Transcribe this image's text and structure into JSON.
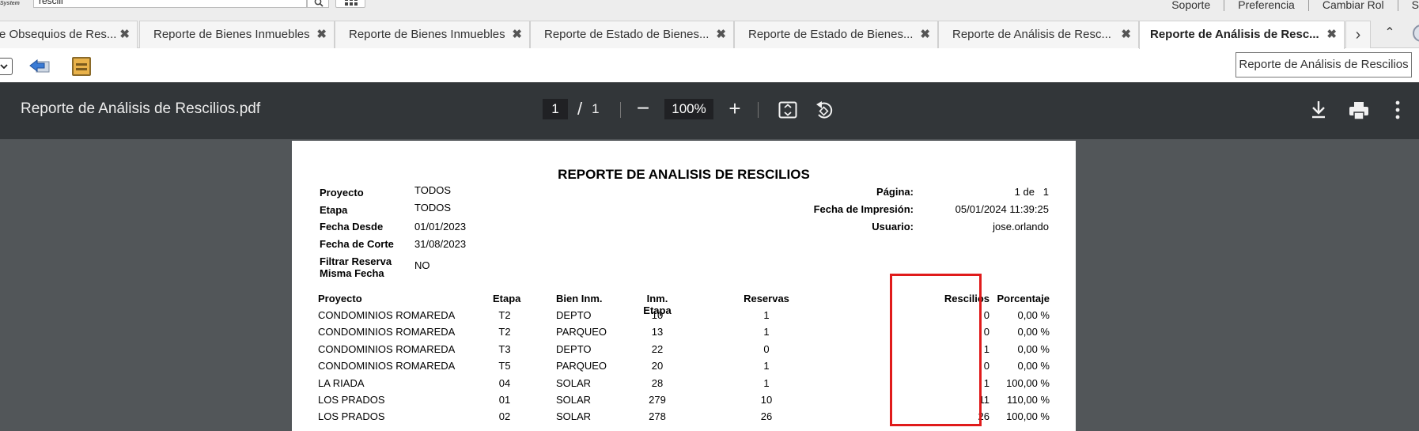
{
  "app": {
    "logo_text": "System",
    "search_value": "rescili",
    "top_links": [
      "Soporte",
      "Preferencia",
      "Cambiar Rol",
      "S"
    ]
  },
  "tabs": [
    {
      "label": "e Obsequios de Res...",
      "active": false
    },
    {
      "label": "Reporte de Bienes Inmuebles",
      "active": false
    },
    {
      "label": "Reporte de Bienes Inmuebles",
      "active": false
    },
    {
      "label": "Reporte de Estado de Bienes...",
      "active": false
    },
    {
      "label": "Reporte de Estado de Bienes...",
      "active": false
    },
    {
      "label": "Reporte de Análisis de Resc...",
      "active": false
    },
    {
      "label": "Reporte de Análisis de Resc...",
      "active": true
    }
  ],
  "tab_controls": {
    "next": "›",
    "collapse": "⌃",
    "close": "✖"
  },
  "tooltip": "Reporte de Análisis de Rescilios",
  "viewer": {
    "file_name": "Reporte de Análisis de Rescilios.pdf",
    "page_current": "1",
    "page_separator": "/",
    "page_total": "1",
    "zoom": "100%",
    "zoom_out": "−",
    "zoom_in": "+"
  },
  "report": {
    "title": "REPORTE DE ANALISIS DE RESCILIOS",
    "header_left": [
      {
        "label": "Proyecto",
        "value": "TODOS"
      },
      {
        "label": "Etapa",
        "value": "TODOS"
      },
      {
        "label": "Fecha Desde",
        "value": "01/01/2023"
      },
      {
        "label": "Fecha de Corte",
        "value": "31/08/2023"
      },
      {
        "label": "Filtrar Reserva",
        "label2": "Misma Fecha",
        "value": "NO"
      }
    ],
    "header_right": [
      {
        "label": "Página:",
        "value": "1 de   1"
      },
      {
        "label": "Fecha de Impresión:",
        "value": "05/01/2024 11:39:25"
      },
      {
        "label": "Usuario:",
        "value": "jose.orlando"
      }
    ],
    "columns": {
      "proyecto": "Proyecto",
      "etapa": "Etapa",
      "bien": "Bien Inm.",
      "inm_etapa": "Inm. Etapa",
      "reservas": "Reservas",
      "rescilios": "Rescilios",
      "porcentaje": "Porcentaje"
    },
    "rows": [
      {
        "proyecto": "CONDOMINIOS ROMAREDA",
        "etapa": "T2",
        "bien": "DEPTO",
        "inm_etapa": "10",
        "reservas": "1",
        "rescilios": "0",
        "porcentaje": "0,00 %"
      },
      {
        "proyecto": "CONDOMINIOS ROMAREDA",
        "etapa": "T2",
        "bien": "PARQUEO",
        "inm_etapa": "13",
        "reservas": "1",
        "rescilios": "0",
        "porcentaje": "0,00 %"
      },
      {
        "proyecto": "CONDOMINIOS ROMAREDA",
        "etapa": "T3",
        "bien": "DEPTO",
        "inm_etapa": "22",
        "reservas": "0",
        "rescilios": "1",
        "porcentaje": "0,00 %"
      },
      {
        "proyecto": "CONDOMINIOS ROMAREDA",
        "etapa": "T5",
        "bien": "PARQUEO",
        "inm_etapa": "20",
        "reservas": "1",
        "rescilios": "0",
        "porcentaje": "0,00 %"
      },
      {
        "proyecto": "LA RIADA",
        "etapa": "04",
        "bien": "SOLAR",
        "inm_etapa": "28",
        "reservas": "1",
        "rescilios": "1",
        "porcentaje": "100,00 %"
      },
      {
        "proyecto": "LOS PRADOS",
        "etapa": "01",
        "bien": "SOLAR",
        "inm_etapa": "279",
        "reservas": "10",
        "rescilios": "11",
        "porcentaje": "110,00 %"
      },
      {
        "proyecto": "LOS PRADOS",
        "etapa": "02",
        "bien": "SOLAR",
        "inm_etapa": "278",
        "reservas": "26",
        "rescilios": "26",
        "porcentaje": "100,00 %"
      }
    ]
  },
  "colors": {
    "viewer_bar": "#323639",
    "viewer_bg": "#525659",
    "highlight": "#e01b1b"
  }
}
